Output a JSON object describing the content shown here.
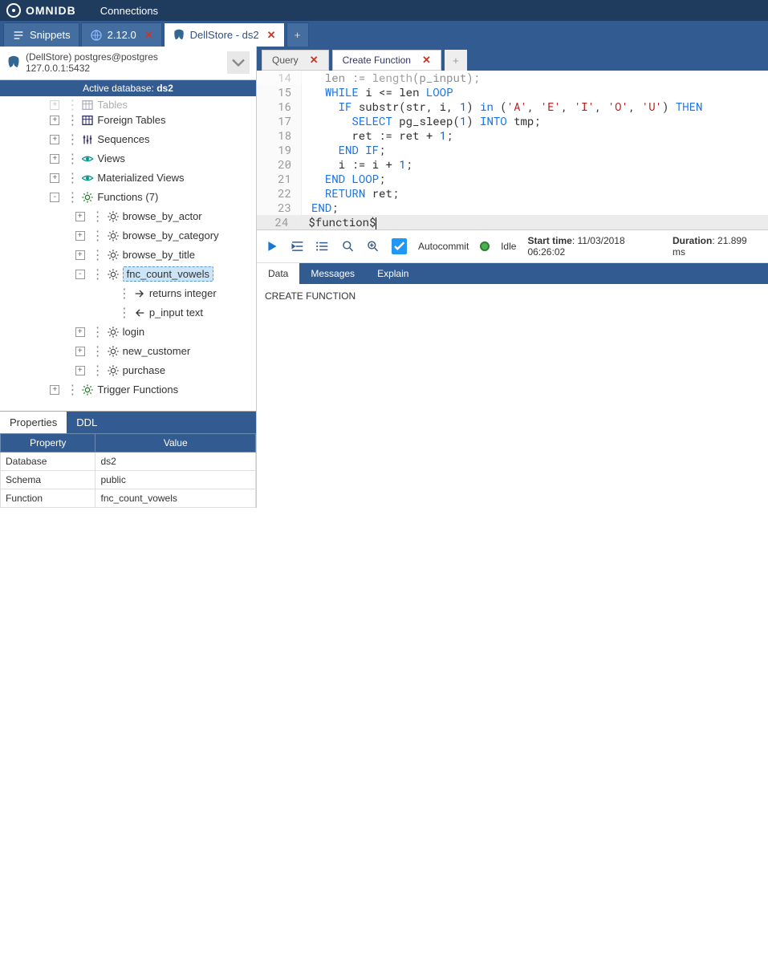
{
  "app": {
    "name": "OMNIDB",
    "connections_label": "Connections"
  },
  "main_tabs": [
    {
      "label": "Snippets",
      "closable": false
    },
    {
      "label": "2.12.0",
      "closable": true
    },
    {
      "label": "DellStore - ds2",
      "closable": true,
      "active": true
    }
  ],
  "connection": {
    "title": "(DellStore) postgres@postgres",
    "host": "127.0.0.1:5432",
    "active_db_prefix": "Active database: ",
    "active_db": "ds2"
  },
  "tree": {
    "items": [
      {
        "indent": 2,
        "toggle": "+",
        "icon": "table",
        "label": "Foreign Tables"
      },
      {
        "indent": 2,
        "toggle": "+",
        "icon": "sequence",
        "label": "Sequences"
      },
      {
        "indent": 2,
        "toggle": "+",
        "icon": "eye",
        "label": "Views"
      },
      {
        "indent": 2,
        "toggle": "+",
        "icon": "eye",
        "label": "Materialized Views"
      },
      {
        "indent": 2,
        "toggle": "-",
        "icon": "gear-green",
        "label": "Functions (7)"
      },
      {
        "indent": 3,
        "toggle": "+",
        "icon": "gear-grey",
        "label": "browse_by_actor"
      },
      {
        "indent": 3,
        "toggle": "+",
        "icon": "gear-grey",
        "label": "browse_by_category"
      },
      {
        "indent": 3,
        "toggle": "+",
        "icon": "gear-grey",
        "label": "browse_by_title"
      },
      {
        "indent": 3,
        "toggle": "-",
        "icon": "gear-grey",
        "label": "fnc_count_vowels",
        "selected": true
      },
      {
        "indent": 4,
        "toggle": "",
        "icon": "arrow-right",
        "label": "returns integer"
      },
      {
        "indent": 4,
        "toggle": "",
        "icon": "arrow-left",
        "label": "p_input text"
      },
      {
        "indent": 3,
        "toggle": "+",
        "icon": "gear-grey",
        "label": "login"
      },
      {
        "indent": 3,
        "toggle": "+",
        "icon": "gear-grey",
        "label": "new_customer"
      },
      {
        "indent": 3,
        "toggle": "+",
        "icon": "gear-grey",
        "label": "purchase"
      },
      {
        "indent": 2,
        "toggle": "+",
        "icon": "gear-green",
        "label": "Trigger Functions"
      }
    ],
    "truncated_top_label": "Tables"
  },
  "props": {
    "tabs": [
      "Properties",
      "DDL"
    ],
    "headers": [
      "Property",
      "Value"
    ],
    "rows": [
      [
        "Database",
        "ds2"
      ],
      [
        "Schema",
        "public"
      ],
      [
        "Function",
        "fnc_count_vowels"
      ]
    ]
  },
  "inner_tabs": [
    {
      "label": "Query",
      "active": false
    },
    {
      "label": "Create Function",
      "active": true
    }
  ],
  "editor": {
    "lines": [
      {
        "n": 14,
        "html": "  len <span class='op'>:=</span> <span class='fn'>length</span>(p_input);",
        "dim": true
      },
      {
        "n": 15,
        "html": "  <span class='kw'>WHILE</span> i <span class='op'>&lt;=</span> len <span class='kw'>LOOP</span>"
      },
      {
        "n": 16,
        "html": "    <span class='kw'>IF</span> substr(str, i, <span class='num'>1</span>) <span class='kw'>in</span> (<span class='str'>'A'</span>, <span class='str'>'E'</span>, <span class='str'>'I'</span>, <span class='str'>'O'</span>, <span class='str'>'U'</span>) <span class='kw'>THEN</span>"
      },
      {
        "n": 17,
        "html": "      <span class='kw'>SELECT</span> pg_sleep(<span class='num'>1</span>) <span class='kw'>INTO</span> tmp;"
      },
      {
        "n": 18,
        "html": "      ret <span class='op'>:=</span> ret <span class='op'>+</span> <span class='num'>1</span>;"
      },
      {
        "n": 19,
        "html": "    <span class='kw'>END IF</span>;"
      },
      {
        "n": 20,
        "html": "    i <span class='op'>:=</span> i <span class='op'>+</span> <span class='num'>1</span>;"
      },
      {
        "n": 21,
        "html": "  <span class='kw'>END LOOP</span>;"
      },
      {
        "n": 22,
        "html": "  <span class='kw'>RETURN</span> ret;"
      },
      {
        "n": 23,
        "html": "<span class='kw'>END</span>;"
      },
      {
        "n": 24,
        "html": "$function$<span class='cursor-caret'></span>",
        "highlight": true
      }
    ]
  },
  "toolbar": {
    "autocommit": "Autocommit",
    "idle": "Idle",
    "start_label": "Start time",
    "start_value": "11/03/2018 06:26:02",
    "duration_label": "Duration",
    "duration_value": "21.899 ms"
  },
  "result": {
    "tabs": [
      "Data",
      "Messages",
      "Explain"
    ],
    "body": "CREATE FUNCTION"
  }
}
